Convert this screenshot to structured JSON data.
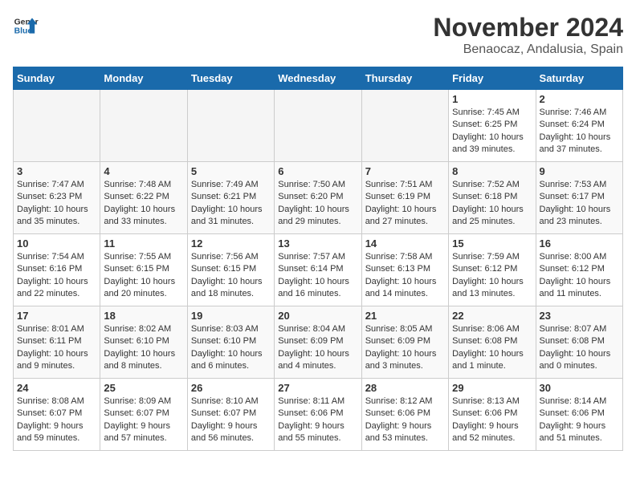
{
  "header": {
    "logo_line1": "General",
    "logo_line2": "Blue",
    "month": "November 2024",
    "location": "Benaocaz, Andalusia, Spain"
  },
  "weekdays": [
    "Sunday",
    "Monday",
    "Tuesday",
    "Wednesday",
    "Thursday",
    "Friday",
    "Saturday"
  ],
  "weeks": [
    [
      {
        "day": "",
        "info": ""
      },
      {
        "day": "",
        "info": ""
      },
      {
        "day": "",
        "info": ""
      },
      {
        "day": "",
        "info": ""
      },
      {
        "day": "",
        "info": ""
      },
      {
        "day": "1",
        "info": "Sunrise: 7:45 AM\nSunset: 6:25 PM\nDaylight: 10 hours\nand 39 minutes."
      },
      {
        "day": "2",
        "info": "Sunrise: 7:46 AM\nSunset: 6:24 PM\nDaylight: 10 hours\nand 37 minutes."
      }
    ],
    [
      {
        "day": "3",
        "info": "Sunrise: 7:47 AM\nSunset: 6:23 PM\nDaylight: 10 hours\nand 35 minutes."
      },
      {
        "day": "4",
        "info": "Sunrise: 7:48 AM\nSunset: 6:22 PM\nDaylight: 10 hours\nand 33 minutes."
      },
      {
        "day": "5",
        "info": "Sunrise: 7:49 AM\nSunset: 6:21 PM\nDaylight: 10 hours\nand 31 minutes."
      },
      {
        "day": "6",
        "info": "Sunrise: 7:50 AM\nSunset: 6:20 PM\nDaylight: 10 hours\nand 29 minutes."
      },
      {
        "day": "7",
        "info": "Sunrise: 7:51 AM\nSunset: 6:19 PM\nDaylight: 10 hours\nand 27 minutes."
      },
      {
        "day": "8",
        "info": "Sunrise: 7:52 AM\nSunset: 6:18 PM\nDaylight: 10 hours\nand 25 minutes."
      },
      {
        "day": "9",
        "info": "Sunrise: 7:53 AM\nSunset: 6:17 PM\nDaylight: 10 hours\nand 23 minutes."
      }
    ],
    [
      {
        "day": "10",
        "info": "Sunrise: 7:54 AM\nSunset: 6:16 PM\nDaylight: 10 hours\nand 22 minutes."
      },
      {
        "day": "11",
        "info": "Sunrise: 7:55 AM\nSunset: 6:15 PM\nDaylight: 10 hours\nand 20 minutes."
      },
      {
        "day": "12",
        "info": "Sunrise: 7:56 AM\nSunset: 6:15 PM\nDaylight: 10 hours\nand 18 minutes."
      },
      {
        "day": "13",
        "info": "Sunrise: 7:57 AM\nSunset: 6:14 PM\nDaylight: 10 hours\nand 16 minutes."
      },
      {
        "day": "14",
        "info": "Sunrise: 7:58 AM\nSunset: 6:13 PM\nDaylight: 10 hours\nand 14 minutes."
      },
      {
        "day": "15",
        "info": "Sunrise: 7:59 AM\nSunset: 6:12 PM\nDaylight: 10 hours\nand 13 minutes."
      },
      {
        "day": "16",
        "info": "Sunrise: 8:00 AM\nSunset: 6:12 PM\nDaylight: 10 hours\nand 11 minutes."
      }
    ],
    [
      {
        "day": "17",
        "info": "Sunrise: 8:01 AM\nSunset: 6:11 PM\nDaylight: 10 hours\nand 9 minutes."
      },
      {
        "day": "18",
        "info": "Sunrise: 8:02 AM\nSunset: 6:10 PM\nDaylight: 10 hours\nand 8 minutes."
      },
      {
        "day": "19",
        "info": "Sunrise: 8:03 AM\nSunset: 6:10 PM\nDaylight: 10 hours\nand 6 minutes."
      },
      {
        "day": "20",
        "info": "Sunrise: 8:04 AM\nSunset: 6:09 PM\nDaylight: 10 hours\nand 4 minutes."
      },
      {
        "day": "21",
        "info": "Sunrise: 8:05 AM\nSunset: 6:09 PM\nDaylight: 10 hours\nand 3 minutes."
      },
      {
        "day": "22",
        "info": "Sunrise: 8:06 AM\nSunset: 6:08 PM\nDaylight: 10 hours\nand 1 minute."
      },
      {
        "day": "23",
        "info": "Sunrise: 8:07 AM\nSunset: 6:08 PM\nDaylight: 10 hours\nand 0 minutes."
      }
    ],
    [
      {
        "day": "24",
        "info": "Sunrise: 8:08 AM\nSunset: 6:07 PM\nDaylight: 9 hours\nand 59 minutes."
      },
      {
        "day": "25",
        "info": "Sunrise: 8:09 AM\nSunset: 6:07 PM\nDaylight: 9 hours\nand 57 minutes."
      },
      {
        "day": "26",
        "info": "Sunrise: 8:10 AM\nSunset: 6:07 PM\nDaylight: 9 hours\nand 56 minutes."
      },
      {
        "day": "27",
        "info": "Sunrise: 8:11 AM\nSunset: 6:06 PM\nDaylight: 9 hours\nand 55 minutes."
      },
      {
        "day": "28",
        "info": "Sunrise: 8:12 AM\nSunset: 6:06 PM\nDaylight: 9 hours\nand 53 minutes."
      },
      {
        "day": "29",
        "info": "Sunrise: 8:13 AM\nSunset: 6:06 PM\nDaylight: 9 hours\nand 52 minutes."
      },
      {
        "day": "30",
        "info": "Sunrise: 8:14 AM\nSunset: 6:06 PM\nDaylight: 9 hours\nand 51 minutes."
      }
    ]
  ]
}
